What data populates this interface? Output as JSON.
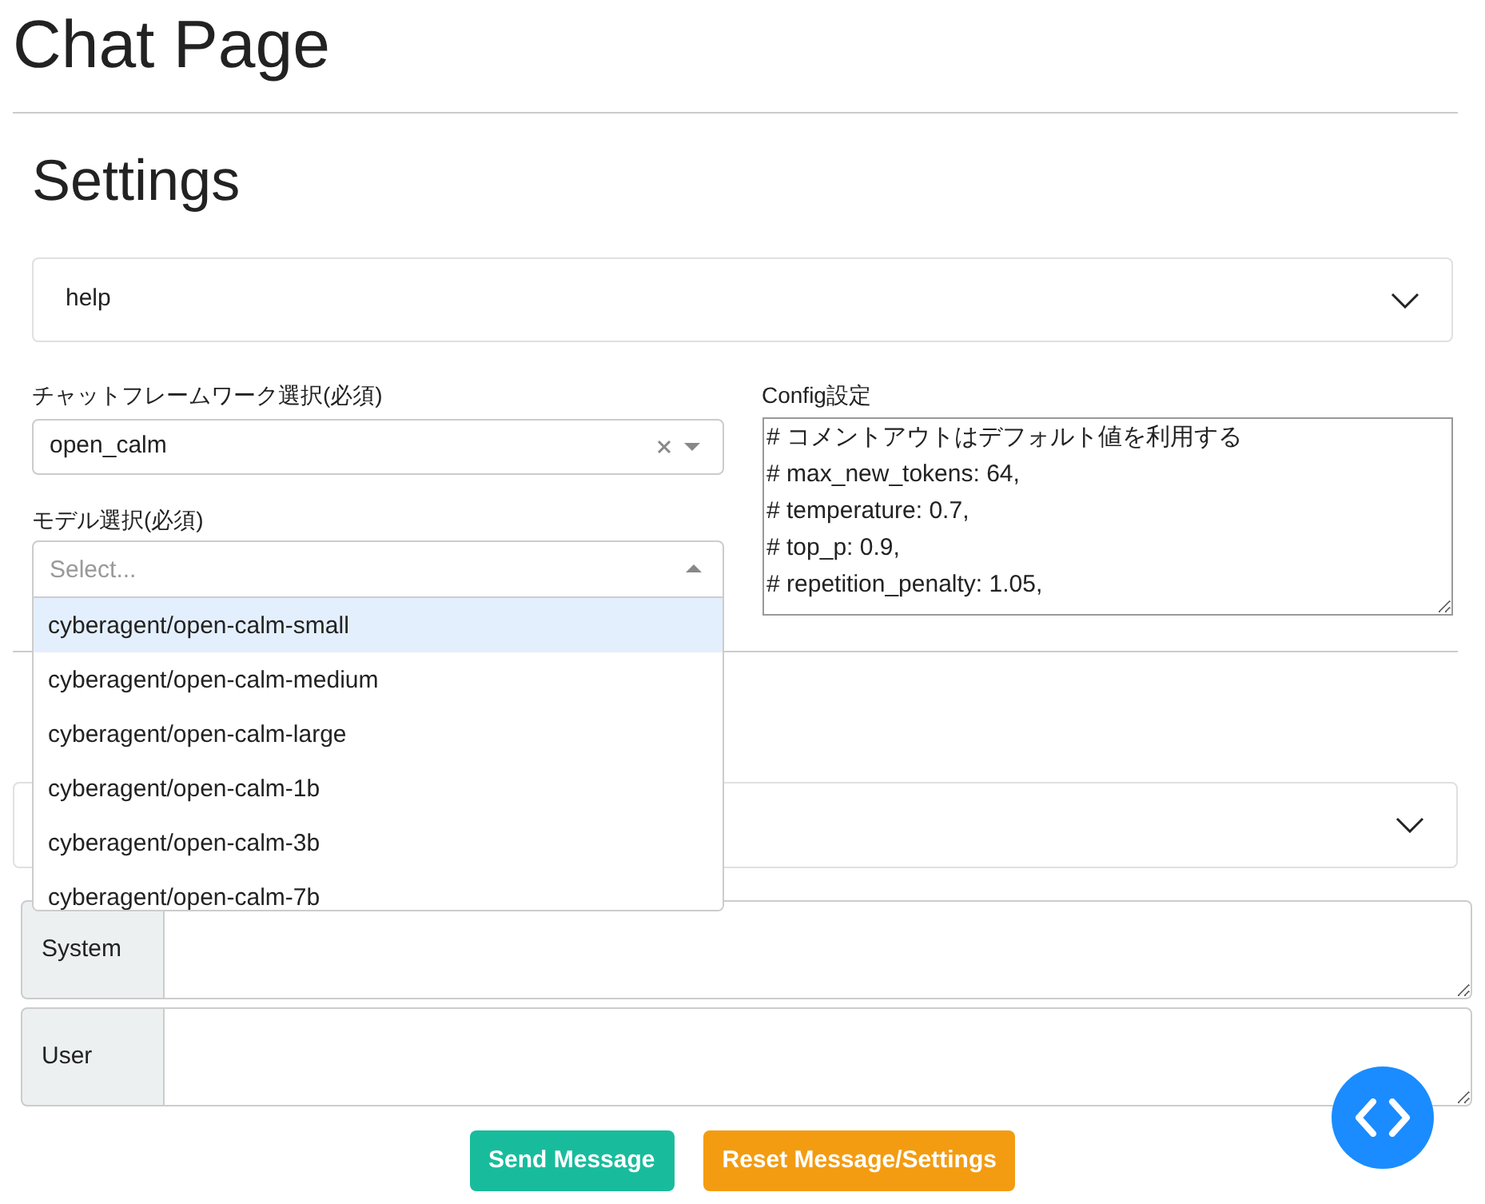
{
  "page_title": "Chat Page",
  "settings": {
    "title": "Settings",
    "help": {
      "label": "help",
      "expanded": false
    },
    "framework": {
      "label": "チャットフレームワーク選択(必須)",
      "value": "open_calm"
    },
    "model": {
      "label": "モデル選択(必須)",
      "placeholder": "Select...",
      "expanded": true,
      "options": [
        {
          "label": "cyberagent/open-calm-small",
          "selected": true
        },
        {
          "label": "cyberagent/open-calm-medium",
          "selected": false
        },
        {
          "label": "cyberagent/open-calm-large",
          "selected": false
        },
        {
          "label": "cyberagent/open-calm-1b",
          "selected": false
        },
        {
          "label": "cyberagent/open-calm-3b",
          "selected": false
        },
        {
          "label": "cyberagent/open-calm-7b",
          "selected": false
        }
      ]
    },
    "config": {
      "label": "Config設定",
      "lines": [
        "# コメントアウトはデフォルト値を利用する",
        "# max_new_tokens: 64,",
        "# temperature: 0.7,",
        "# top_p: 0.9,",
        "# repetition_penalty: 1.05,"
      ]
    }
  },
  "chat": {
    "accordion": {
      "expanded": false
    },
    "roles": [
      {
        "label": "System"
      },
      {
        "label": "User"
      }
    ]
  },
  "buttons": [
    {
      "label": "Send Message",
      "kind": "primary"
    },
    {
      "label": "Reset Message/Settings",
      "kind": "warning"
    }
  ]
}
